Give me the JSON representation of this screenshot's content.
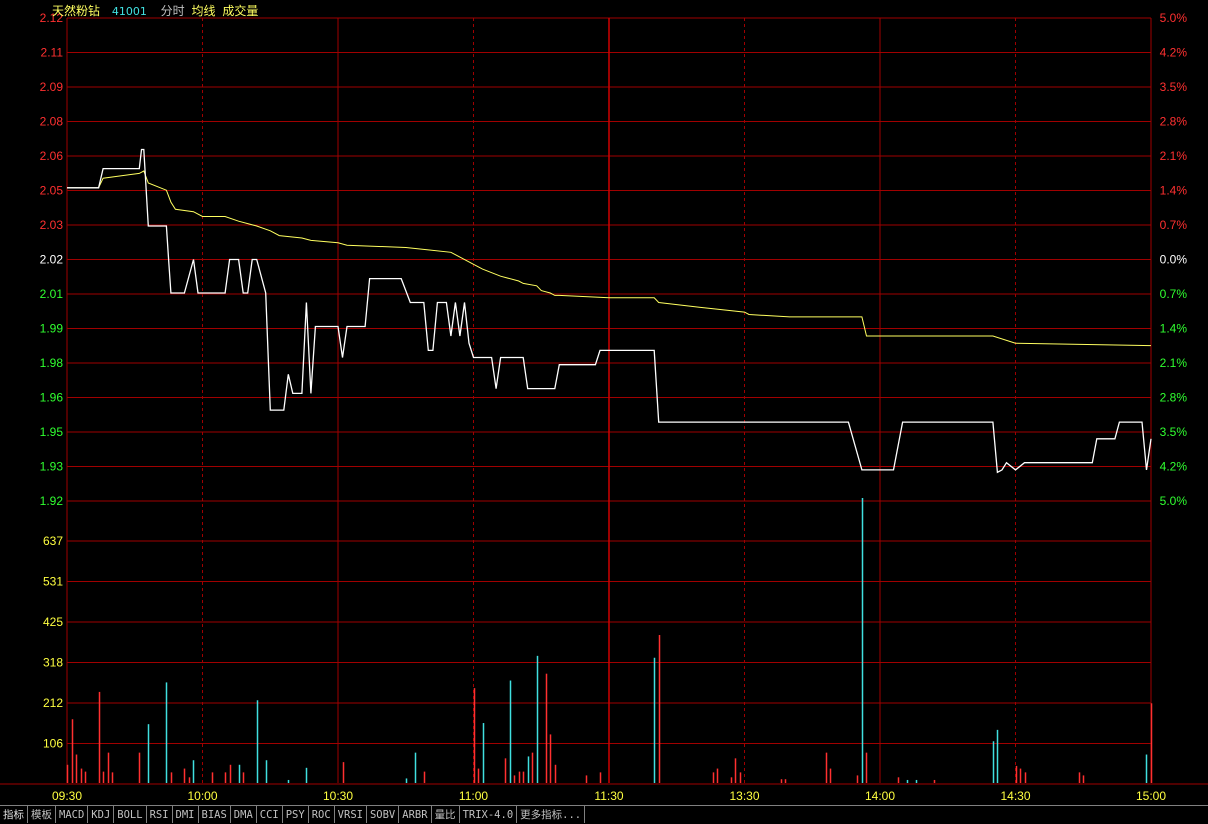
{
  "header": {
    "stock_name": "天然粉钻",
    "stock_code": "41001",
    "labels": [
      "分时",
      "均线",
      "成交量"
    ]
  },
  "colors": {
    "background": "#000000",
    "grid": "#a00000",
    "up": "#ff3030",
    "down": "#30ff30",
    "neutral": "#ffffff",
    "volume_axis": "#ffff40",
    "price_line": "#ffffff",
    "avg_line": "#ffff60",
    "volume_up": "#ff3030",
    "volume_down": "#40e0e0"
  },
  "tabs": [
    "指标",
    "模板",
    "MACD",
    "KDJ",
    "BOLL",
    "RSI",
    "DMI",
    "BIAS",
    "DMA",
    "CCI",
    "PSY",
    "ROC",
    "VRSI",
    "SOBV",
    "ARBR",
    "量比",
    "TRIX-4.0",
    "更多指标..."
  ],
  "chart_data": {
    "type": "line",
    "reference_price": 2.02,
    "price_ticks": [
      "2.12",
      "2.11",
      "2.09",
      "2.08",
      "2.06",
      "2.05",
      "2.03",
      "2.02",
      "2.01",
      "1.99",
      "1.98",
      "1.96",
      "1.95",
      "1.93",
      "1.92"
    ],
    "price_tick_colors": [
      "up",
      "up",
      "up",
      "up",
      "up",
      "up",
      "up",
      "neutral",
      "down",
      "down",
      "down",
      "down",
      "down",
      "down",
      "down"
    ],
    "percent_ticks": [
      "5.0%",
      "4.2%",
      "3.5%",
      "2.8%",
      "2.1%",
      "1.4%",
      "0.7%",
      "0.0%",
      "0.7%",
      "1.4%",
      "2.1%",
      "2.8%",
      "3.5%",
      "4.2%",
      "5.0%"
    ],
    "percent_tick_colors": [
      "up",
      "up",
      "up",
      "up",
      "up",
      "up",
      "up",
      "neutral",
      "down",
      "down",
      "down",
      "down",
      "down",
      "down",
      "down"
    ],
    "ylim": [
      1.919,
      2.121
    ],
    "volume_ticks": [
      "637",
      "531",
      "425",
      "318",
      "212",
      "106"
    ],
    "volume_ylim": [
      0,
      743
    ],
    "time_labels": [
      "09:30",
      "10:00",
      "10:30",
      "11:00",
      "11:30",
      "13:30",
      "14:00",
      "14:30",
      "15:00"
    ],
    "minutes_total": 240,
    "series": [
      {
        "key": "price",
        "points": [
          [
            0,
            2.05
          ],
          [
            7,
            2.05
          ],
          [
            8,
            2.058
          ],
          [
            16,
            2.058
          ],
          [
            16,
            2.058
          ],
          [
            16,
            2.058
          ],
          [
            16,
            2.058
          ],
          [
            16.5,
            2.066
          ],
          [
            17,
            2.066
          ],
          [
            18,
            2.034
          ],
          [
            22,
            2.034
          ],
          [
            22.5,
            2.02
          ],
          [
            23,
            2.006
          ],
          [
            26,
            2.006
          ],
          [
            28,
            2.02
          ],
          [
            29,
            2.006
          ],
          [
            35,
            2.006
          ],
          [
            36,
            2.02
          ],
          [
            38,
            2.02
          ],
          [
            39,
            2.006
          ],
          [
            40,
            2.006
          ],
          [
            41,
            2.02
          ],
          [
            42,
            2.02
          ],
          [
            44,
            2.006
          ],
          [
            45,
            1.957
          ],
          [
            48,
            1.957
          ],
          [
            49,
            1.972
          ],
          [
            50,
            1.964
          ],
          [
            52,
            1.964
          ],
          [
            53,
            2.002
          ],
          [
            54,
            1.964
          ],
          [
            55,
            1.992
          ],
          [
            60,
            1.992
          ],
          [
            61,
            1.979
          ],
          [
            62,
            1.992
          ],
          [
            66,
            1.992
          ],
          [
            67,
            2.012
          ],
          [
            74,
            2.012
          ],
          [
            76,
            2.002
          ],
          [
            79,
            2.002
          ],
          [
            80,
            1.982
          ],
          [
            81,
            1.982
          ],
          [
            82,
            2.002
          ],
          [
            84,
            2.002
          ],
          [
            85,
            1.988
          ],
          [
            86,
            2.002
          ],
          [
            87,
            1.988
          ],
          [
            88,
            2.002
          ],
          [
            89,
            1.985
          ],
          [
            90,
            1.979
          ],
          [
            94,
            1.979
          ],
          [
            95,
            1.966
          ],
          [
            96,
            1.979
          ],
          [
            101,
            1.979
          ],
          [
            102,
            1.966
          ],
          [
            108,
            1.966
          ],
          [
            109,
            1.976
          ],
          [
            117,
            1.976
          ],
          [
            118,
            1.982
          ],
          [
            130,
            1.982
          ],
          [
            131,
            1.952
          ],
          [
            173,
            1.952
          ],
          [
            176,
            1.932
          ],
          [
            183,
            1.932
          ],
          [
            185,
            1.952
          ],
          [
            205,
            1.952
          ],
          [
            206,
            1.931
          ],
          [
            207,
            1.932
          ],
          [
            208,
            1.935
          ],
          [
            210,
            1.932
          ],
          [
            212,
            1.935
          ],
          [
            227,
            1.935
          ],
          [
            228,
            1.945
          ],
          [
            232,
            1.945
          ],
          [
            233,
            1.952
          ],
          [
            238,
            1.952
          ],
          [
            239,
            1.932
          ],
          [
            240,
            1.945
          ]
        ]
      },
      {
        "key": "average",
        "points": [
          [
            0,
            2.05
          ],
          [
            7,
            2.05
          ],
          [
            8,
            2.054
          ],
          [
            16,
            2.056
          ],
          [
            17,
            2.057
          ],
          [
            18,
            2.052
          ],
          [
            22,
            2.049
          ],
          [
            23,
            2.044
          ],
          [
            24,
            2.041
          ],
          [
            28,
            2.04
          ],
          [
            30,
            2.038
          ],
          [
            35,
            2.038
          ],
          [
            38,
            2.036
          ],
          [
            42,
            2.034
          ],
          [
            45,
            2.032
          ],
          [
            47,
            2.03
          ],
          [
            52,
            2.029
          ],
          [
            54,
            2.028
          ],
          [
            60,
            2.027
          ],
          [
            62,
            2.026
          ],
          [
            75,
            2.025
          ],
          [
            80,
            2.024
          ],
          [
            85,
            2.023
          ],
          [
            86,
            2.022
          ],
          [
            90,
            2.018
          ],
          [
            92,
            2.016
          ],
          [
            96,
            2.013
          ],
          [
            100,
            2.011
          ],
          [
            101,
            2.01
          ],
          [
            104,
            2.009
          ],
          [
            105,
            2.007
          ],
          [
            107,
            2.006
          ],
          [
            108,
            2.005
          ],
          [
            109,
            2.005
          ],
          [
            120,
            2.004
          ],
          [
            130,
            2.004
          ],
          [
            131,
            2.002
          ],
          [
            140,
            2.0
          ],
          [
            150,
            1.998
          ],
          [
            151,
            1.997
          ],
          [
            160,
            1.996
          ],
          [
            176,
            1.996
          ],
          [
            177,
            1.988
          ],
          [
            205,
            1.988
          ],
          [
            210,
            1.985
          ],
          [
            240,
            1.984
          ]
        ]
      },
      {
        "key": "volume",
        "bars": [
          [
            0,
            48,
            "u"
          ],
          [
            1,
            168,
            "u"
          ],
          [
            2,
            75,
            "u"
          ],
          [
            3,
            38,
            "u"
          ],
          [
            4,
            30,
            "u"
          ],
          [
            7,
            240,
            "u"
          ],
          [
            8,
            30,
            "u"
          ],
          [
            9,
            80,
            "u"
          ],
          [
            10,
            28,
            "u"
          ],
          [
            16,
            80,
            "u"
          ],
          [
            18,
            155,
            "d"
          ],
          [
            22,
            265,
            "d"
          ],
          [
            23,
            28,
            "u"
          ],
          [
            26,
            38,
            "u"
          ],
          [
            27,
            15,
            "u"
          ],
          [
            28,
            60,
            "d"
          ],
          [
            32,
            28,
            "u"
          ],
          [
            35,
            28,
            "u"
          ],
          [
            36,
            48,
            "u"
          ],
          [
            38,
            48,
            "d"
          ],
          [
            39,
            28,
            "u"
          ],
          [
            42,
            218,
            "d"
          ],
          [
            44,
            60,
            "d"
          ],
          [
            49,
            8,
            "d"
          ],
          [
            53,
            40,
            "d"
          ],
          [
            61,
            55,
            "u"
          ],
          [
            75,
            12,
            "d"
          ],
          [
            77,
            80,
            "d"
          ],
          [
            79,
            30,
            "u"
          ],
          [
            90,
            250,
            "u"
          ],
          [
            91,
            38,
            "u"
          ],
          [
            92,
            158,
            "d"
          ],
          [
            97,
            65,
            "u"
          ],
          [
            98,
            270,
            "d"
          ],
          [
            99,
            20,
            "u"
          ],
          [
            100,
            30,
            "u"
          ],
          [
            101,
            30,
            "u"
          ],
          [
            102,
            70,
            "d"
          ],
          [
            103,
            80,
            "u"
          ],
          [
            104,
            335,
            "d"
          ],
          [
            106,
            288,
            "u"
          ],
          [
            107,
            128,
            "u"
          ],
          [
            108,
            48,
            "u"
          ],
          [
            115,
            20,
            "u"
          ],
          [
            118,
            28,
            "u"
          ],
          [
            130,
            330,
            "d"
          ],
          [
            131,
            390,
            "u"
          ],
          [
            143,
            28,
            "u"
          ],
          [
            144,
            38,
            "u"
          ],
          [
            147,
            15,
            "u"
          ],
          [
            148,
            65,
            "u"
          ],
          [
            149,
            28,
            "u"
          ],
          [
            158,
            10,
            "u"
          ],
          [
            159,
            10,
            "u"
          ],
          [
            168,
            80,
            "u"
          ],
          [
            169,
            38,
            "u"
          ],
          [
            175,
            20,
            "u"
          ],
          [
            176,
            880,
            "d"
          ],
          [
            177,
            80,
            "u"
          ],
          [
            184,
            15,
            "u"
          ],
          [
            186,
            8,
            "d"
          ],
          [
            188,
            8,
            "d"
          ],
          [
            192,
            8,
            "u"
          ],
          [
            205,
            110,
            "d"
          ],
          [
            206,
            140,
            "d"
          ],
          [
            210,
            45,
            "u"
          ],
          [
            211,
            38,
            "u"
          ],
          [
            212,
            28,
            "u"
          ],
          [
            224,
            28,
            "u"
          ],
          [
            225,
            20,
            "u"
          ],
          [
            239,
            75,
            "d"
          ],
          [
            240,
            210,
            "u"
          ]
        ]
      }
    ]
  }
}
